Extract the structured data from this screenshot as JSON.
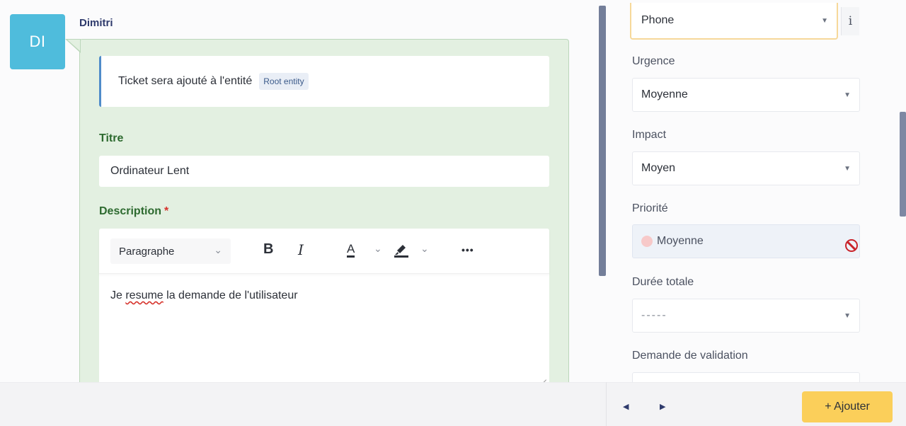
{
  "author": {
    "initials": "DI",
    "name": "Dimitri"
  },
  "entity_notice": {
    "text": "Ticket sera ajouté à l'entité",
    "badge": "Root entity"
  },
  "form": {
    "title_label": "Titre",
    "title_value": "Ordinateur Lent",
    "description_label": "Description",
    "required_mark": "*",
    "editor": {
      "paragraph_select": "Paragraphe",
      "bold": "B",
      "italic": "I",
      "text_color": "A",
      "more": "•••",
      "content_before": "Je ",
      "content_misspelled": "resume",
      "content_after": " la demande de l'utilisateur"
    }
  },
  "side_panel": {
    "source_value": "Phone",
    "info_button": "i",
    "fields": [
      {
        "label": "Urgence",
        "value": "Moyenne"
      },
      {
        "label": "Impact",
        "value": "Moyen"
      },
      {
        "label": "Priorité",
        "value": "Moyenne"
      },
      {
        "label": "Durée totale",
        "value": "-----"
      },
      {
        "label": "Demande de validation",
        "value": ""
      }
    ]
  },
  "footer": {
    "prev_arrow": "◀",
    "next_arrow": "▶",
    "add_button": "+ Ajouter"
  },
  "colors": {
    "avatar": "#4fbcdc",
    "bubble": "#e3f0e1",
    "label_green": "#2d6a2f",
    "add_button": "#fbcf5a",
    "ban_icon": "#c9232a"
  }
}
